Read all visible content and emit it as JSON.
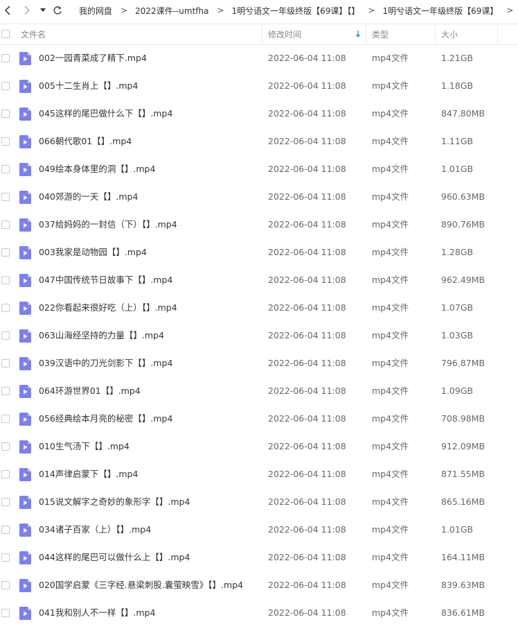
{
  "nav": {
    "breadcrumbs": [
      "我的网盘",
      "2022课件--umtfha",
      "1明兮语文一年级终版【69课】【】",
      "1明兮语文一年级终版【69课】"
    ],
    "separator": ">"
  },
  "columns": {
    "name": "文件名",
    "modified": "修改时间",
    "type": "类型",
    "size": "大小"
  },
  "files": [
    {
      "name": "002一园青菜成了精下.mp4",
      "modified": "2022-06-04 11:08",
      "type": "mp4文件",
      "size": "1.21GB"
    },
    {
      "name": "005十二生肖上【】.mp4",
      "modified": "2022-06-04 11:08",
      "type": "mp4文件",
      "size": "1.18GB"
    },
    {
      "name": "045这样的尾巴做什么下【】.mp4",
      "modified": "2022-06-04 11:08",
      "type": "mp4文件",
      "size": "847.80MB"
    },
    {
      "name": "066朝代歌01【】.mp4",
      "modified": "2022-06-04 11:08",
      "type": "mp4文件",
      "size": "1.11GB"
    },
    {
      "name": "049绘本身体里的洞【】.mp4",
      "modified": "2022-06-04 11:08",
      "type": "mp4文件",
      "size": "1.01GB"
    },
    {
      "name": "040郊游的一天【】.mp4",
      "modified": "2022-06-04 11:08",
      "type": "mp4文件",
      "size": "960.63MB"
    },
    {
      "name": "037给妈妈的一封信（下）【】.mp4",
      "modified": "2022-06-04 11:08",
      "type": "mp4文件",
      "size": "890.76MB"
    },
    {
      "name": "003我家是动物园【】.mp4",
      "modified": "2022-06-04 11:08",
      "type": "mp4文件",
      "size": "1.28GB"
    },
    {
      "name": "047中国传统节日故事下【】.mp4",
      "modified": "2022-06-04 11:08",
      "type": "mp4文件",
      "size": "962.49MB"
    },
    {
      "name": "022你看起来很好吃（上）【】.mp4",
      "modified": "2022-06-04 11:08",
      "type": "mp4文件",
      "size": "1.07GB"
    },
    {
      "name": "063山海经坚持的力量【】.mp4",
      "modified": "2022-06-04 11:08",
      "type": "mp4文件",
      "size": "1.03GB"
    },
    {
      "name": "039汉语中的刀光剑影下【】.mp4",
      "modified": "2022-06-04 11:08",
      "type": "mp4文件",
      "size": "796.87MB"
    },
    {
      "name": "064环游世界01【】.mp4",
      "modified": "2022-06-04 11:08",
      "type": "mp4文件",
      "size": "1.09GB"
    },
    {
      "name": "056经典绘本月亮的秘密【】.mp4",
      "modified": "2022-06-04 11:08",
      "type": "mp4文件",
      "size": "708.98MB"
    },
    {
      "name": "010生气汤下【】.mp4",
      "modified": "2022-06-04 11:08",
      "type": "mp4文件",
      "size": "912.09MB"
    },
    {
      "name": "014声律启蒙下【】.mp4",
      "modified": "2022-06-04 11:08",
      "type": "mp4文件",
      "size": "871.55MB"
    },
    {
      "name": "015说文解字之奇妙的象形字【】.mp4",
      "modified": "2022-06-04 11:08",
      "type": "mp4文件",
      "size": "865.16MB"
    },
    {
      "name": "034诸子百家（上）【】.mp4",
      "modified": "2022-06-04 11:08",
      "type": "mp4文件",
      "size": "1.01GB"
    },
    {
      "name": "044这样的尾巴可以做什么上【】.mp4",
      "modified": "2022-06-04 11:08",
      "type": "mp4文件",
      "size": "164.11MB"
    },
    {
      "name": "020国学启蒙《三字经.悬梁刺股.囊萤映雪》【】.mp4",
      "modified": "2022-06-04 11:08",
      "type": "mp4文件",
      "size": "839.63MB"
    },
    {
      "name": "041我和别人不一样【】.mp4",
      "modified": "2022-06-04 11:08",
      "type": "mp4文件",
      "size": "836.61MB"
    }
  ],
  "colors": {
    "icon": "#7b7ff0",
    "icon_fold": "#b8baf7",
    "sort_arrow": "#3b8ee8"
  }
}
